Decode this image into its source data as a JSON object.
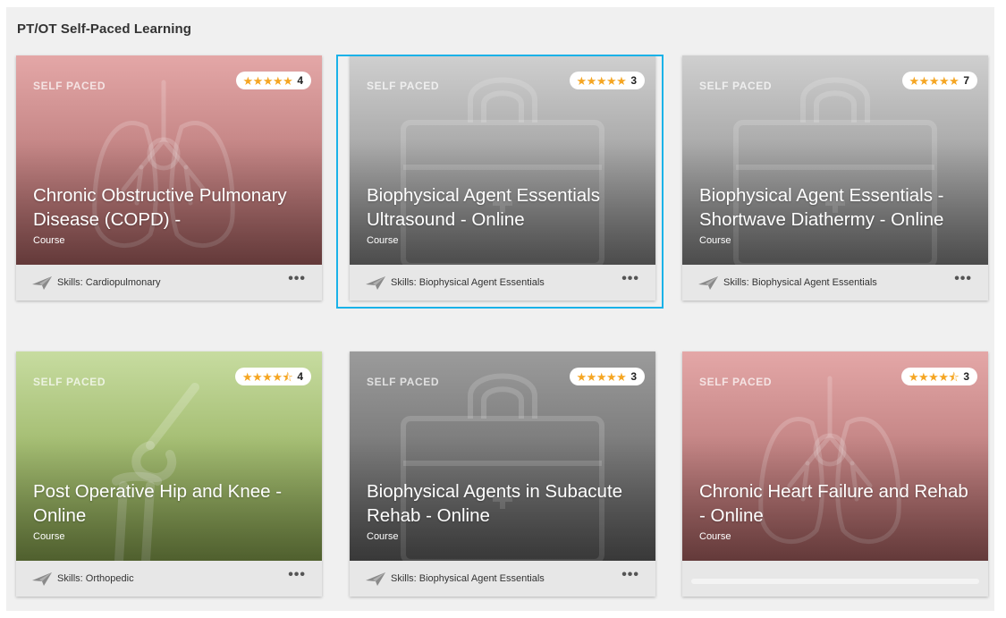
{
  "section": {
    "title": "PT/OT Self-Paced Learning"
  },
  "colors": {
    "star": "#f5a623",
    "focus": "#1ab2e8"
  },
  "cards": [
    {
      "badge": "SELF PACED",
      "rating": {
        "stars": "★★★★★",
        "value": 5,
        "count": "4"
      },
      "title": "Chronic Obstructive Pulmonary Disease (COPD) -",
      "type": "Course",
      "skills": "Skills: Cardiopulmonary",
      "more": "•••",
      "icon": "lungs-icon",
      "theme": "red"
    },
    {
      "badge": "SELF PACED",
      "rating": {
        "stars": "★★★★★",
        "value": 5,
        "count": "3"
      },
      "title": "Biophysical Agent Essentials Ultrasound - Online",
      "type": "Course",
      "skills": "Skills: Biophysical Agent Essentials",
      "more": "•••",
      "icon": "toolbox-icon",
      "theme": "gray",
      "focused": true
    },
    {
      "badge": "SELF PACED",
      "rating": {
        "stars": "★★★★★",
        "value": 5,
        "count": "7"
      },
      "title": "Biophysical Agent Essentials - Shortwave Diathermy - Online",
      "type": "Course",
      "skills": "Skills: Biophysical Agent Essentials",
      "more": "•••",
      "icon": "toolbox-icon",
      "theme": "gray"
    },
    {
      "badge": "SELF PACED",
      "rating": {
        "stars": "★★★★⯪",
        "value": 4.5,
        "count": "4"
      },
      "title": "Post Operative Hip and Knee - Online",
      "type": "Course",
      "skills": "Skills: Orthopedic",
      "more": "•••",
      "icon": "knee-joint-icon",
      "theme": "green"
    },
    {
      "badge": "SELF PACED",
      "rating": {
        "stars": "★★★★★",
        "value": 5,
        "count": "3"
      },
      "title": "Biophysical Agents in Subacute Rehab - Online",
      "type": "Course",
      "skills": "Skills: Biophysical Agent Essentials",
      "more": "•••",
      "icon": "toolbox-icon",
      "theme": "dark"
    },
    {
      "badge": "SELF PACED",
      "rating": {
        "stars": "★★★★⯪",
        "value": 4.5,
        "count": "3"
      },
      "title": "Chronic Heart Failure and Rehab - Online",
      "type": "Course",
      "skills": "",
      "more": "",
      "icon": "lungs-icon",
      "theme": "red"
    }
  ]
}
